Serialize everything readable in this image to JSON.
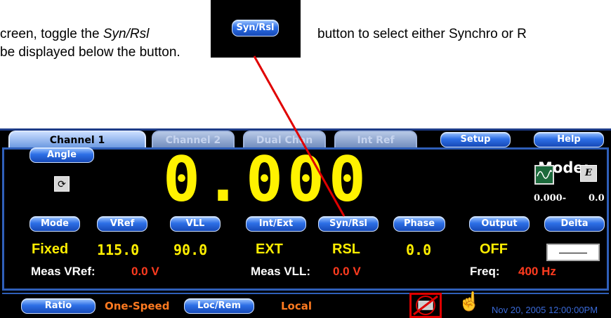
{
  "document": {
    "line1_start": "creen, toggle the ",
    "line1_italic": "Syn/Rsl",
    "line1_end": "button to select either Synchro or R",
    "line2": "be displayed below the button.",
    "callout_label": "Syn/Rsl"
  },
  "tabs": [
    {
      "label": "Channel 1",
      "active": true
    },
    {
      "label": "Channel 2",
      "active": false
    },
    {
      "label": "Dual Chan",
      "active": false
    },
    {
      "label": "Int Ref",
      "active": false
    }
  ],
  "header_buttons": {
    "setup": "Setup",
    "help": "Help"
  },
  "readout": {
    "angle_label": "Angle",
    "main_value": "0.000",
    "refresh_icon": "refresh-icon"
  },
  "mode_panel": {
    "title": "Mode:",
    "waveform_icon": "sine-wave-icon",
    "e_icon_label": "E",
    "range_min": "0.000-",
    "range_max": "0.0"
  },
  "function_buttons": {
    "mode": "Mode",
    "vref": "VRef",
    "vll": "VLL",
    "int_ext": "Int/Ext",
    "syn_rsl": "Syn/Rsl",
    "phase": "Phase",
    "output": "Output",
    "delta": "Delta"
  },
  "values": {
    "mode": "Fixed",
    "vref": "115.0",
    "vll": "90.0",
    "int_ext": "EXT",
    "syn_rsl": "RSL",
    "phase": "0.0",
    "output": "OFF"
  },
  "measurements": {
    "meas_vref_label": "Meas VRef:",
    "meas_vref_value": "0.0 V",
    "meas_vll_label": "Meas VLL:",
    "meas_vll_value": "0.0 V",
    "freq_label": "Freq:",
    "freq_value": "400 Hz"
  },
  "bottom_bar": {
    "ratio_button": "Ratio",
    "ratio_value": "One-Speed",
    "loc_rem_button": "Loc/Rem",
    "loc_rem_value": "Local",
    "no_signal_icon": "no-connection-icon",
    "pointer_icon": "hand-pointer-icon",
    "datetime": "Nov 20, 2005 12:00:00PM"
  },
  "colors": {
    "digit_yellow": "#fff200",
    "button_blue": "#2d6fe6",
    "value_red": "#ff3b1f",
    "status_orange": "#ff7a20",
    "frame_blue": "#2f5fb9"
  }
}
